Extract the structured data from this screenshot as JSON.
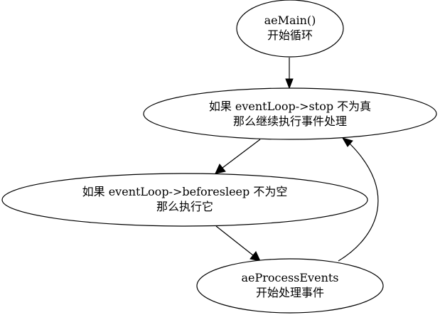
{
  "diagram": {
    "nodes": [
      {
        "id": "aemain",
        "line1": "aeMain()",
        "line2": "开始循环"
      },
      {
        "id": "stop-check",
        "line1": "如果 eventLoop->stop 不为真",
        "line2": "那么继续执行事件处理"
      },
      {
        "id": "beforesleep",
        "line1": "如果 eventLoop->beforesleep 不为空",
        "line2": "那么执行它"
      },
      {
        "id": "process-events",
        "line1": "aeProcessEvents",
        "line2": "开始处理事件"
      }
    ],
    "edges": [
      {
        "from": "aemain",
        "to": "stop-check"
      },
      {
        "from": "stop-check",
        "to": "beforesleep"
      },
      {
        "from": "beforesleep",
        "to": "process-events"
      },
      {
        "from": "process-events",
        "to": "stop-check"
      }
    ]
  }
}
